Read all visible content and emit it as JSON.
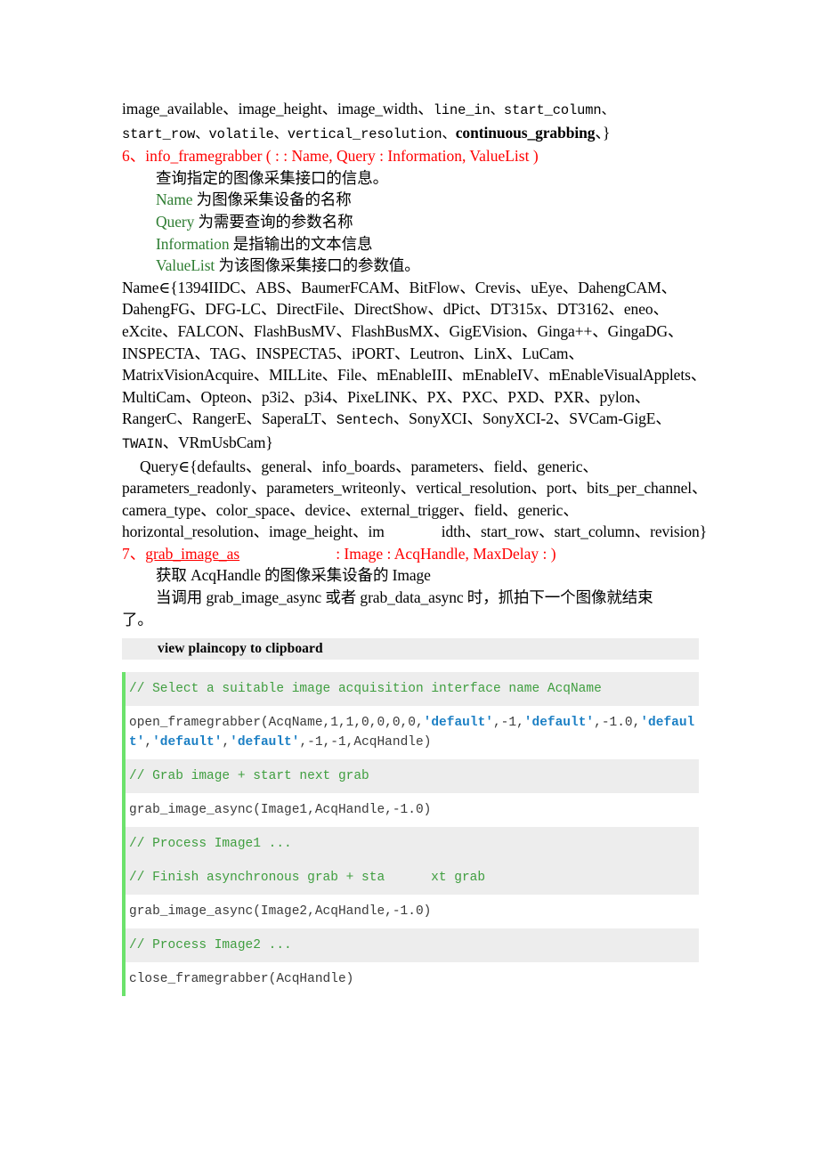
{
  "document": {
    "line1": {
      "serif_part": "image_available、image_height、image_width、",
      "mono_part": "line_in、start_column、"
    },
    "line2": {
      "mono_part": "start_row、volatile、vertical_resolution、",
      "bold_part": "continuous_grabbing",
      "tail": "、}"
    },
    "section6": {
      "heading": "6、info_framegrabber ( : : Name, Query : Information, ValueList )",
      "desc": "查询指定的图像采集接口的信息。",
      "params": [
        {
          "term": "Name",
          "text": " 为图像采集设备的名称"
        },
        {
          "term": "Query",
          "text": " 为需要查询的参数名称"
        },
        {
          "term": "Information",
          "text": " 是指输出的文本信息"
        },
        {
          "term": "ValueList",
          "text": " 为该图像采集接口的参数值。"
        }
      ],
      "name_set": {
        "prefix": "Name∈{",
        "items_line1_serif": "1394IIDC、ABS、BaumerFCAM、BitFlow、Crevis、uEye、",
        "items_line2_serif": "DahengCAM、DahengFG、DFG-LC、DirectFile、DirectShow、dPict、DT315x、DT3162、",
        "items_line3_serif": "eneo、eXcite、FALCON、FlashBusMV、FlashBusMX、GigEVision、Ginga++、",
        "items_line4_serif": "GingaDG、INSPECTA、TAG、INSPECTA5、iPORT、Leutron、LinX、LuCam、",
        "items_line5_serif": "MatrixVisionAcquire、MILLite、File、mEnableIII、mEnableIV、mEnableVisualApplets、",
        "items_line6_serif": "MultiCam、Opteon、p3i2、p3i4、PixeLINK、PX、PXC、PXD、PXR、pylon、",
        "items_line7a_serif": "RangerC、RangerE、SaperaLT、",
        "items_line7_mono": "Sentech",
        "items_line7b_serif": "、SonyXCI、SonyXCI-2、SVCam-GigE、",
        "items_line8_mono": "TWAIN",
        "items_line8b_serif": "、VRmUsbCam}"
      },
      "query_set": {
        "prefix": "Query∈{",
        "line1": "defaults、general、info_boards、parameters、field、generic、",
        "line2": "parameters_readonly、parameters_writeonly、vertical_resolution、port、",
        "line3": "bits_per_channel、camera_type、color_space、device、external_trigger、field、",
        "line4a": "generic、horizontal_resolution、image_height、im",
        "line4b": "idth、start_row、",
        "line5": "start_column、revision}"
      }
    },
    "section7": {
      "heading_index": "7、",
      "heading_name": "grab_image_as",
      "heading_rest": ": Image : AcqHandle, MaxDelay : )",
      "desc1": "获取 AcqHandle 的图像采集设备的 Image",
      "desc2": "当调用 grab_image_async 或者 grab_data_async 时，抓拍下一个图像就结束",
      "desc3": "了。"
    },
    "code_block": {
      "toolbar": {
        "view": "view",
        "plaincopy": "plaincopy",
        "to_clipboard": "to clipboard",
        "full": "view plaincopy to clipboard"
      },
      "lines": [
        {
          "type": "comment",
          "shaded": true,
          "text": "// Select a suitable image acquisition interface name AcqName"
        },
        {
          "type": "code",
          "shaded": false,
          "segments": [
            {
              "style": "plain",
              "text": "open_framegrabber(AcqName,1,1,0,0,0,0,"
            },
            {
              "style": "kw",
              "text": "'default'"
            },
            {
              "style": "plain",
              "text": ",-1,"
            },
            {
              "style": "kw",
              "text": "'default'"
            },
            {
              "style": "plain",
              "text": ",-1.0,"
            },
            {
              "style": "kw",
              "text": "'default'"
            },
            {
              "style": "plain",
              "text": ","
            },
            {
              "style": "kw",
              "text": "'default'"
            },
            {
              "style": "plain",
              "text": ","
            },
            {
              "style": "kw",
              "text": "'default'"
            },
            {
              "style": "plain",
              "text": ",-1,-1,AcqHandle)"
            }
          ]
        },
        {
          "type": "comment",
          "shaded": true,
          "text": "// Grab image + start next grab"
        },
        {
          "type": "code",
          "shaded": false,
          "segments": [
            {
              "style": "plain",
              "text": "grab_image_async(Image1,AcqHandle,-1.0)"
            }
          ]
        },
        {
          "type": "comment",
          "shaded": true,
          "text": "// Process Image1 ..."
        },
        {
          "type": "comment-gap",
          "shaded": true,
          "text_before": "// Finish asynchronous grab + sta",
          "text_after": "xt grab"
        },
        {
          "type": "code",
          "shaded": false,
          "segments": [
            {
              "style": "plain",
              "text": "grab_image_async(Image2,AcqHandle,-1.0)"
            }
          ]
        },
        {
          "type": "comment",
          "shaded": true,
          "text": "// Process Image2 ..."
        },
        {
          "type": "code",
          "shaded": false,
          "segments": [
            {
              "style": "plain",
              "text": "close_framegrabber(AcqHandle)"
            }
          ]
        }
      ]
    }
  },
  "colors": {
    "red_heading": "#ff0000",
    "green_param": "#2e7d32",
    "code_comment": "#3f9e3f",
    "code_keyword": "#1b7fc4",
    "code_shade_bg": "#ededed",
    "code_left_bar": "#6ce26c"
  }
}
